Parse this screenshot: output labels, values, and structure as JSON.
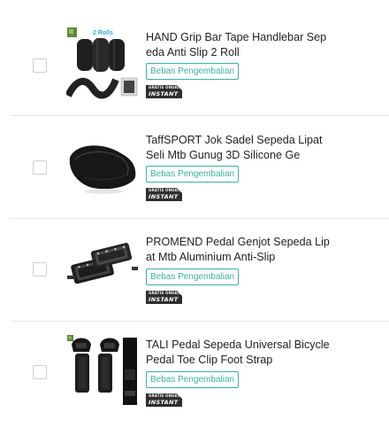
{
  "products": [
    {
      "title": "HAND Grip Bar Tape Handlebar Sepeda Anti Slip 2 Roll",
      "badge": "Bebas Pengembalian",
      "shipping": {
        "line1": "GRATIS ONGKIR",
        "line2": "INSTANT"
      },
      "thumb_label": "2 Rolls",
      "image_icon": "bar-tape-rolls"
    },
    {
      "title": "TaffSPORT Jok Sadel Sepeda Lipat Seli Mtb Gunug 3D Silicone Ge",
      "badge": "Bebas Pengembalian",
      "shipping": {
        "line1": "GRATIS ONGKIR",
        "line2": "INSTANT"
      },
      "image_icon": "saddle"
    },
    {
      "title": "PROMEND Pedal Genjot Sepeda Lipat Mtb Aluminium Anti-Slip",
      "badge": "Bebas Pengembalian",
      "shipping": {
        "line1": "GRATIS ONGKIR",
        "line2": "INSTANT"
      },
      "image_icon": "pedals"
    },
    {
      "title": "TALI Pedal Sepeda Universal Bicycle Pedal Toe Clip Foot Strap",
      "badge": "Bebas Pengembalian",
      "shipping": {
        "line1": "GRATIS ONGKIR",
        "line2": "INSTANT"
      },
      "image_icon": "foot-straps"
    }
  ]
}
